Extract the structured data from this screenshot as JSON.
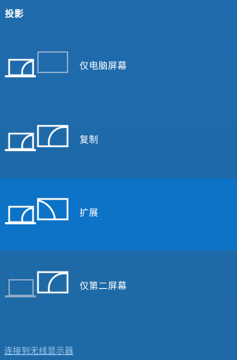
{
  "panel": {
    "title": "投影",
    "options": [
      {
        "label": "仅电脑屏幕",
        "icon": "pc-screen-only-icon",
        "selected": false
      },
      {
        "label": "复制",
        "icon": "duplicate-icon",
        "selected": false
      },
      {
        "label": "扩展",
        "icon": "extend-icon",
        "selected": true
      },
      {
        "label": "仅第二屏幕",
        "icon": "second-screen-only-icon",
        "selected": false
      }
    ],
    "wireless_link": "连接到无线显示器"
  },
  "colors": {
    "background": "#1f6bad",
    "selected": "#0c73c7",
    "link": "#9fcaf0",
    "dim_icon": "#8aa9c8"
  }
}
